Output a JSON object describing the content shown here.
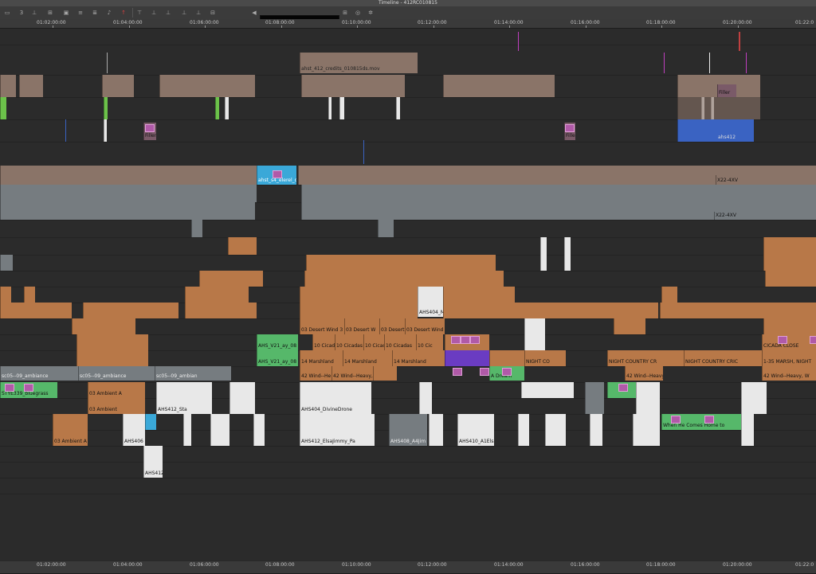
{
  "window": {
    "title": "Timeline - 412RC010815"
  },
  "toolbar": {
    "icons": [
      "track-select-icon",
      "marker-icon",
      "split-icon",
      "lift-icon",
      "overwrite-icon",
      "extract-icon",
      "trim-icon",
      "audio-icon",
      "mixer-icon",
      "link-icon",
      "segment-red-icon",
      "segment-yellow-icon",
      "zoom-out-icon",
      "zoom-in-icon",
      "focus-icon",
      "settings-icon"
    ],
    "timecode_display": ""
  },
  "ruler": {
    "labels": [
      "01:02:00:00",
      "01:04:00:00",
      "01:06:00:00",
      "01:08:00:00",
      "01:10:00:00",
      "01:12:00:00",
      "01:14:00:00",
      "01:16:00:00",
      "01:18:00:00",
      "01:20:00:00",
      "01:22:0"
    ]
  },
  "clips": {
    "credits": "ahst_412_credits_010815ds.mov",
    "filler_a": "Filler",
    "filler_b": "Filler",
    "filler_c": "Filler",
    "ahs_v4": "ahs412",
    "elerel": "ahst_s4_elerel_d",
    "x22a": "X22-4XV",
    "x22b": "X22-4XV",
    "ahs404m": "AHS404_M",
    "desert1": "03 Desert Wind 3",
    "desert2": "03 Desert W",
    "desert3": "03 Desert",
    "desert4": "03 Desert Wind",
    "cicadas1": "10 Cicada",
    "cicadas2": "10 Cicadas",
    "cicadas3": "10 Cicad",
    "cicadas4": "10 Cicadas",
    "cicadas5": "10 Cic",
    "ahs_v21a": "AHS_V21_ay_08",
    "ahs_v21b": "AHS_V21_ay_08",
    "marsh1": "14 Marshland",
    "marsh2": "14 Marshland",
    "marsh3": "14 Marshland",
    "nightcountry1": "NIGHT COUNTRY CR",
    "nightcountry2": "NIGHT COUNTRY CRIC",
    "cicada_close": "CICADA CLOSE",
    "marsh_night": "1-35 MARSH, NIGHT",
    "wind1": "42 Wind--He",
    "wind2": "42 Wind--Heavy,",
    "wind3": "42 Wind--Heavy",
    "wind4": "42 Wind--Heavy, W",
    "ambiance1": "sc05--09_ambiance",
    "ambiance2": "sc05--09_ambiance",
    "ambiance3": "sc05--09_ambian",
    "styes": "STYE339_bluegrass",
    "ambient1": "03 Ambient A",
    "ambient2": "03 Ambient",
    "ambient3": "03 Ambient A",
    "ambient4": "03 Ambient A",
    "ahs412st1": "AHS412_Sta",
    "ahs412st2": "AHS412_Sta",
    "divine1": "AHS404_DivineDrone",
    "divine2": "AHS404_DivineDrone",
    "elsa1": "AHS412_ElsaJimmy_Pa",
    "elsa2": "AHS412_ElsaJimmy_Pa",
    "a408_1": "AHS408_A4Jim",
    "a408_2": "AHS408_A4Jim",
    "a410_1": "AHS410_A1Elsa",
    "a410_2": "AHS410_A1Elsa",
    "when_he_comes": "When He Comes Home to",
    "ahs406": "AHS406",
    "ahs412a": "AHS412",
    "adream": "A Dream",
    "night_cc": "NIGHT CO"
  }
}
